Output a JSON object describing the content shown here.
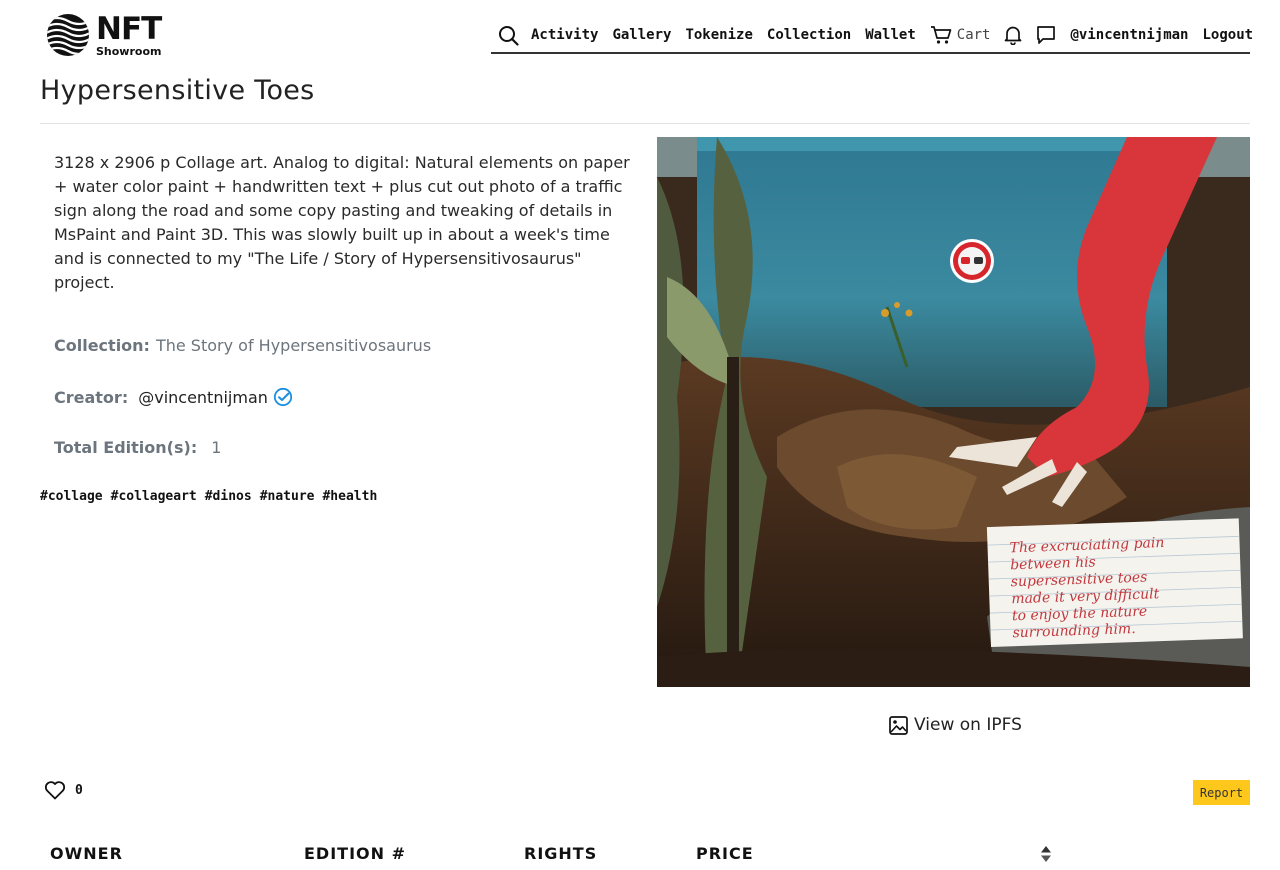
{
  "logo": {
    "title": "NFT",
    "subtitle": "Showroom"
  },
  "nav": {
    "links": [
      "Activity",
      "Gallery",
      "Tokenize",
      "Collection",
      "Wallet"
    ],
    "cart_label": "Cart",
    "username": "@vincentnijman",
    "logout": "Logout",
    "icons": [
      "search-icon",
      "cart-icon",
      "bell-icon",
      "chat-icon"
    ]
  },
  "artwork": {
    "title": "Hypersensitive Toes",
    "description": "3128 x 2906 p Collage art. Analog to digital: Natural elements on paper + water color paint + handwritten text + plus cut out photo of a traffic sign along the road and some copy pasting and tweaking of details in MsPaint and Paint 3D. This was slowly built up in about a week's time and is connected to my \"The Life / Story of Hypersensitivosaurus\" project.",
    "collection_label": "Collection:",
    "collection_value": "The Story of Hypersensitivosaurus",
    "creator_label": "Creator:",
    "creator_value": "@vincentnijman",
    "editions_label": "Total Edition(s):",
    "editions_value": "1",
    "tags": [
      "#collage",
      "#collageart",
      "#dinos",
      "#nature",
      "#health"
    ],
    "image_note_lines": [
      "The excruciating pain",
      "between his",
      "supersensitive toes",
      "made it very difficult",
      "to enjoy the nature",
      "surrounding him."
    ],
    "ipfs_label": "View on IPFS"
  },
  "likes": {
    "count": "0"
  },
  "report_label": "Report",
  "table": {
    "headers": [
      "OWNER",
      "EDITION #",
      "RIGHTS",
      "PRICE"
    ]
  },
  "colors": {
    "accent_blue": "#1b8fe0",
    "report_yellow": "#fdc71b",
    "nav_border": "#333333"
  }
}
